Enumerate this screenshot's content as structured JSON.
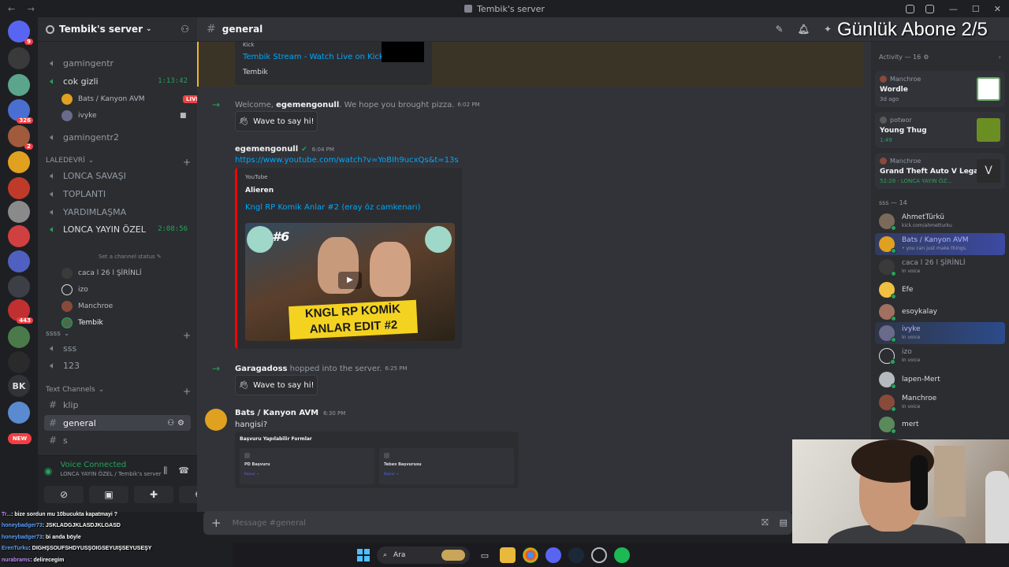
{
  "window": {
    "title": "Tembik's server",
    "nav_glyphs": "← →",
    "controls": [
      "—",
      "☐",
      "✕"
    ]
  },
  "overlay_title": "Günlük Abone 2/5",
  "guilds": [
    {
      "name": "discord-home",
      "color": "#5865f2",
      "badge": "9"
    },
    {
      "name": "server-2",
      "color": "#3a3a3a",
      "badge": ""
    },
    {
      "name": "server-3",
      "color": "#5aa58c",
      "badge": ""
    },
    {
      "name": "server-4",
      "color": "#4a6fd0",
      "badge": "326"
    },
    {
      "name": "server-5",
      "color": "#a05a3c",
      "badge": "2"
    },
    {
      "name": "server-6",
      "color": "#e0a020",
      "badge": ""
    },
    {
      "name": "server-7",
      "color": "#c03a2a",
      "badge": ""
    },
    {
      "name": "server-8",
      "color": "#8a8a8a",
      "badge": ""
    },
    {
      "name": "server-9",
      "color": "#d04040",
      "badge": ""
    },
    {
      "name": "server-10",
      "color": "#5060c0",
      "badge": ""
    },
    {
      "name": "server-11",
      "color": "#313338",
      "badge": ""
    },
    {
      "name": "server-12",
      "color": "#c03030",
      "badge": "443"
    },
    {
      "name": "server-13",
      "color": "#4a7a4a",
      "badge": ""
    },
    {
      "name": "server-14",
      "color": "#2a2a2a",
      "badge": ""
    }
  ],
  "guild_text_items": [
    "BK",
    "NEW"
  ],
  "server": {
    "name": "Tembik's server",
    "channels": [
      {
        "type": "voice",
        "name": "gamingentr",
        "time": ""
      },
      {
        "type": "voice",
        "name": "cok gizli",
        "time": "1:13:42"
      },
      {
        "type": "voice",
        "name": "gamingentr2",
        "time": ""
      },
      {
        "type": "voice",
        "name": "LONCA SAVAŞI",
        "time": ""
      },
      {
        "type": "voice",
        "name": "TOPLANTI",
        "time": ""
      },
      {
        "type": "voice",
        "name": "YARDIMLAŞMA",
        "time": ""
      },
      {
        "type": "voice",
        "name": "LONCA YAYIN ÖZEL",
        "time": "2:08:56"
      },
      {
        "type": "voice",
        "name": "sss",
        "time": ""
      },
      {
        "type": "voice",
        "name": "123",
        "time": ""
      },
      {
        "type": "text",
        "name": "klip",
        "time": ""
      },
      {
        "type": "text",
        "name": "general",
        "time": ""
      },
      {
        "type": "text",
        "name": "s",
        "time": ""
      }
    ],
    "voice_users_cok": [
      {
        "name": "Bats / Kanyon AVM",
        "live": "LIVE"
      },
      {
        "name": "ivyke",
        "live": ""
      }
    ],
    "set_status": "Set a channel status",
    "voice_users_lonca": [
      "caca l 26 l ŞİRİNLİ",
      "izo",
      "Manchroe",
      "Tembik"
    ],
    "categories": [
      "LALEDEVRİ",
      "ssss",
      "Text Channels"
    ]
  },
  "voice": {
    "status": "Voice Connected",
    "location": "LONCA YAYIN ÖZEL / Tembik's server"
  },
  "chat": {
    "channel": "general",
    "top_embed": {
      "provider": "Kick",
      "title": "Tembik Stream - Watch Live on Kick",
      "author": "Tembik"
    },
    "welcome1": {
      "prefix": "Welcome,",
      "user": "egemengonull",
      "suffix": ". We hope you brought pizza.",
      "time": "6:02 PM",
      "wave": "Wave to say hi!"
    },
    "msg1": {
      "author": "egemengonull",
      "time": "6:04 PM",
      "link": "https://www.youtube.com/watch?v=YoBIh9ucxQs&t=13s",
      "provider": "YouTube",
      "channel": "Alieren",
      "video_title": "Kngl RP Komik Anlar #2 (eray öz camkenarı)",
      "thumb_num": "#6",
      "thumb_text": "KNGL RP KOMİK ANLAR EDIT #2"
    },
    "welcome2": {
      "user": "Garagadoss",
      "suffix": "hopped into the server.",
      "time": "6:25 PM",
      "wave": "Wave to say hi!"
    },
    "msg2": {
      "author": "Bats / Kanyon AVM",
      "time": "6:30 PM",
      "text": "hangisi?",
      "card_title": "Başvuru Yapılabilir Formlar",
      "form1": "PD Başvuru",
      "form2": "Tebex Başvurusu",
      "apply": "Başvur →"
    },
    "composer_placeholder": "Message #general"
  },
  "activity": {
    "header": "Activity — 16",
    "cards": [
      {
        "user": "Manchroe",
        "game": "Wordle",
        "meta": "3d ago",
        "meta_green": false,
        "art_color": "#6aaa64"
      },
      {
        "user": "potwor",
        "game": "Young Thug",
        "meta": "1:49",
        "meta_green": true,
        "art_color": "#6b8e23"
      },
      {
        "user": "Manchroe",
        "game": "Grand Theft Auto V Legacy",
        "meta": "52:28 · LONCA YAYIN ÖZ...",
        "meta_green": true,
        "art_color": "#2b2b2b"
      }
    ]
  },
  "members": {
    "header": "sss — 14",
    "list": [
      {
        "name": "AhmetTürkü",
        "sub": "kick.com/ahmetturku",
        "color": "#7a6a5a",
        "hl": ""
      },
      {
        "name": "Bats / Kanyon AVM",
        "sub": "• you can just make things.",
        "color": "#e0a020",
        "hl": "hl"
      },
      {
        "name": "caca l 26 l ŞİRİNLİ",
        "sub": "In voice",
        "color": "#3a3a3a",
        "hl": ""
      },
      {
        "name": "Efe",
        "sub": "",
        "color": "#f0c040",
        "hl": ""
      },
      {
        "name": "esoykalay",
        "sub": "",
        "color": "#a07060",
        "hl": ""
      },
      {
        "name": "ivyke",
        "sub": "In voice",
        "color": "#6a6a8a",
        "hl": "hl2"
      },
      {
        "name": "izo",
        "sub": "In voice",
        "color": "#dbdee1",
        "hl": ""
      },
      {
        "name": "lapen-Mert",
        "sub": "",
        "color": "#b5bac1",
        "hl": ""
      },
      {
        "name": "Manchroe",
        "sub": "In voice",
        "color": "#8a4a3a",
        "hl": ""
      },
      {
        "name": "mert",
        "sub": "",
        "color": "#5a8a5a",
        "hl": ""
      }
    ]
  },
  "stream_chat": [
    {
      "user": "Tr...",
      "text": ": bize sordun mu 10bucukta kapatmayi ?"
    },
    {
      "user": "honeybadger73",
      "text": ": JSKLADGJKLASDJKLGASD"
    },
    {
      "user": "honeybadger73",
      "text": ": bi anda böyle"
    },
    {
      "user": "ErenTurku",
      "text": ": DIGHŞSOUFSHDYUSŞOIGSEYUIŞSEYUSEŞY"
    },
    {
      "user": "nurabrams",
      "text": ": delirecegim"
    }
  ],
  "taskbar": {
    "search": "Ara"
  }
}
